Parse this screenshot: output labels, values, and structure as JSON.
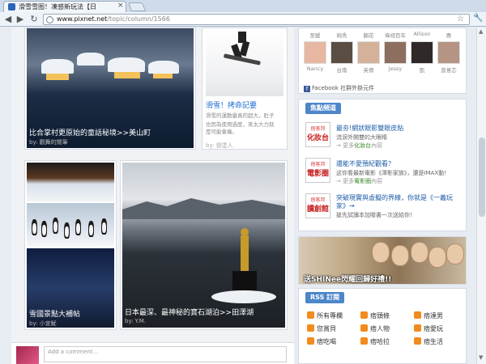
{
  "browser": {
    "tab_title": "滑雪雪图！凍感新玩法【日",
    "tab_close": "×",
    "url_host": "www.pixnet.net",
    "url_path": "/topic/column/1566",
    "back": "◀",
    "forward": "▶",
    "reload": "↻",
    "star": "☆",
    "wrench": "🔧"
  },
  "cards": {
    "village_caption": "比合掌村更原始的童話秘境>>美山町",
    "village_by": "by: 觀舞的閒筆",
    "ski_title": "滑雪！拷命記要",
    "ski_desc": [
      "滑雪的運動量真的超大，肚子",
      "也因為使用過度，笑太大力就",
      "是可能會痛。"
    ],
    "ski_by": "by: 鄧塗人",
    "collage_caption": "雪國景點大補帖",
    "collage_by": "by: 小宣魷",
    "lake_caption": "日本最深、最神秘的寶石湖泊>>田澤湖",
    "lake_by": "by: Y.M."
  },
  "sidebar": {
    "friends_row1": [
      "至媛",
      "婉秀",
      "翻花",
      "偉翊百年",
      "Allison",
      "惠"
    ],
    "friends_row2": [
      "Nancy",
      "台南",
      "英倩",
      "Jessy",
      "凱",
      "曾意芯"
    ],
    "fb_plugin": "Facebook 社群外掛元件",
    "focus_heading": "焦點頻道",
    "features": [
      {
        "badge_top": "痞客邦",
        "badge_main": "化妝台",
        "title": "最夯!網狀眼影雙眼皮貼",
        "desc": "流淚外開雙的大眼睛",
        "more_prefix": "→ 更多",
        "more_link": "化妝台",
        "more_suffix": "內容"
      },
      {
        "badge_top": "痞客邦",
        "badge_main": "電影圈",
        "title": "還能不愛預紀觀看？",
        "desc": "这你看最新電影《澤影家族》，還是IMAX動！",
        "more_prefix": "→ 更多",
        "more_link": "電影圈",
        "more_suffix": "內容"
      },
      {
        "badge_top": "痞客邦",
        "badge_main": "讀創館",
        "title": "突破現實與虛擬的界線，你就是《一義玩",
        "title2": "家》→",
        "desc": "搶先試讀本加贈書一次送給你！",
        "more_prefix": "",
        "more_link": "",
        "more_suffix": ""
      }
    ],
    "banner_text": "送SHINee閃耀回歸好禮!!",
    "rss_heading": "RSS 訂閱",
    "rss_items": [
      "所有專欄",
      "痞頭條",
      "痞達男",
      "您賞貝",
      "痞人物",
      "痞愛玩",
      "痞吃喝",
      "痞哈拉",
      "痞生活"
    ]
  },
  "comment": {
    "placeholder": "Add a comment..."
  }
}
